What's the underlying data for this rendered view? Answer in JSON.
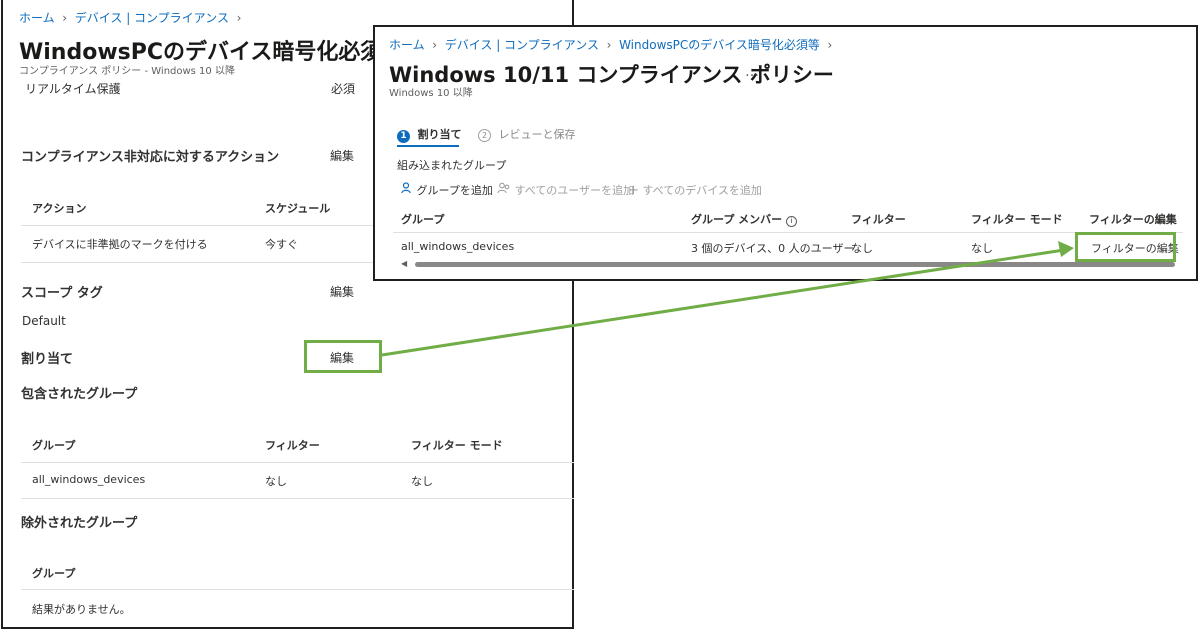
{
  "left": {
    "breadcrumb": [
      "ホーム",
      "デバイス | コンプライアンス"
    ],
    "title": "WindowsPCのデバイス暗号化必須等",
    "more": "…",
    "subtitle": "コンプライアンス ポリシー - Windows 10 以降",
    "realtime": {
      "label": "リアルタイム保護",
      "value": "必須"
    },
    "actions": {
      "heading": "コンプライアンス非対応に対するアクション",
      "edit": "編集",
      "columns": [
        "アクション",
        "スケジュール"
      ],
      "row": [
        "デバイスに非準拠のマークを付ける",
        "今すぐ"
      ]
    },
    "scope": {
      "heading": "スコープ タグ",
      "edit": "編集",
      "value": "Default"
    },
    "assignment": {
      "heading": "割り当て",
      "edit": "編集"
    },
    "included": {
      "heading": "包含されたグループ",
      "columns": [
        "グループ",
        "フィルター",
        "フィルター モード"
      ],
      "row": [
        "all_windows_devices",
        "なし",
        "なし"
      ]
    },
    "excluded": {
      "heading": "除外されたグループ",
      "column": "グループ",
      "empty": "結果がありません。"
    }
  },
  "right": {
    "breadcrumb": [
      "ホーム",
      "デバイス | コンプライアンス",
      "WindowsPCのデバイス暗号化必須等"
    ],
    "title": "Windows 10/11 コンプライアンス ポリシー",
    "more": "…",
    "subtitle": "Windows 10 以降",
    "steps": [
      {
        "num": "1",
        "label": "割り当て"
      },
      {
        "num": "2",
        "label": "レビューと保存"
      }
    ],
    "included_label": "組み込まれたグループ",
    "commands": [
      "グループを追加",
      "すべてのユーザーを追加",
      "すべてのデバイスを追加"
    ],
    "columns": [
      "グループ",
      "グループ メンバー",
      "フィルター",
      "フィルター モード",
      "フィルターの編集"
    ],
    "row": [
      "all_windows_devices",
      "3 個のデバイス、0 人のユーザー",
      "なし",
      "なし",
      "フィルターの編集"
    ],
    "scroll_left": "◀"
  },
  "colors": {
    "highlight": "#70ad47",
    "link": "#0f6cbd",
    "border": "#1f1f1f"
  }
}
